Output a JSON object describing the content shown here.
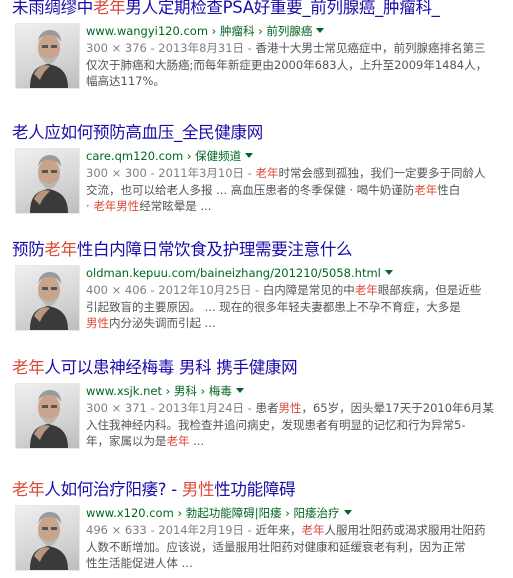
{
  "results": [
    {
      "title_parts": [
        {
          "text": "未雨绸缪中",
          "hl": false
        },
        {
          "text": "老年",
          "hl": true
        },
        {
          "text": "男人定期检查PSA好重要_前列腺癌_肿瘤科_",
          "hl": false
        }
      ],
      "url": "www.wangyi120.com",
      "crumbs": "› 肿瘤科 › 前列腺癌",
      "snippet_lines": [
        [
          {
            "text": "300 × 376 - 2013年8月31日 - ",
            "cls": "meta"
          },
          {
            "text": "香港十大男士常见癌症中，前列腺癌排名第三",
            "cls": ""
          }
        ],
        [
          {
            "text": "仅次于肺癌和大肠癌;而每年新症更由2000年683人，上升至2009年1484人，",
            "cls": ""
          }
        ],
        [
          {
            "text": "幅高达117%。",
            "cls": ""
          }
        ]
      ]
    },
    {
      "title_parts": [
        {
          "text": "老人应如何预防高血压_全民健康网",
          "hl": false
        }
      ],
      "url": "care.qm120.com",
      "crumbs": "› 保健频道",
      "snippet_lines": [
        [
          {
            "text": "300 × 300 - 2011年3月10日 - ",
            "cls": "meta"
          },
          {
            "text": "老年",
            "cls": "hl"
          },
          {
            "text": "时常会感到孤独，我们一定要多于同龄人",
            "cls": ""
          }
        ],
        [
          {
            "text": "交流，也可以给老人多报 ... 高血压患者的冬季保健 · 喝牛奶谨防",
            "cls": ""
          },
          {
            "text": "老年",
            "cls": "hl"
          },
          {
            "text": "性白",
            "cls": ""
          }
        ],
        [
          {
            "text": "· ",
            "cls": ""
          },
          {
            "text": "老年男性",
            "cls": "hl"
          },
          {
            "text": "经常眩晕是 ...",
            "cls": ""
          }
        ]
      ]
    },
    {
      "title_parts": [
        {
          "text": "预防",
          "hl": false
        },
        {
          "text": "老年",
          "hl": true
        },
        {
          "text": "性白内障日常饮食及护理需要注意什么",
          "hl": false
        }
      ],
      "url": "oldman.kepuu.com/baineizhang/201210/5058.html",
      "crumbs": "",
      "snippet_lines": [
        [
          {
            "text": "400 × 406 - 2012年10月25日 - ",
            "cls": "meta"
          },
          {
            "text": "白内障是常见的中",
            "cls": ""
          },
          {
            "text": "老年",
            "cls": "hl"
          },
          {
            "text": "眼部疾病，但是近些",
            "cls": ""
          }
        ],
        [
          {
            "text": "引起致盲的主要原因。 ... 现在的很多年轻夫妻都患上不孕不育症，大多是",
            "cls": ""
          }
        ],
        [
          {
            "text": "男性",
            "cls": "hl"
          },
          {
            "text": "内分泌失调而引起 ...",
            "cls": ""
          }
        ]
      ]
    },
    {
      "title_parts": [
        {
          "text": "老年",
          "hl": true
        },
        {
          "text": "人可以患神经梅毒  男科  携手健康网",
          "hl": false
        }
      ],
      "url": "www.xsjk.net",
      "crumbs": "› 男科 › 梅毒",
      "snippet_lines": [
        [
          {
            "text": "300 × 371 - 2013年1月24日 - ",
            "cls": "meta"
          },
          {
            "text": "患者",
            "cls": ""
          },
          {
            "text": "男性",
            "cls": "hl"
          },
          {
            "text": "，65岁，因头晕17天于2010年6月某",
            "cls": ""
          }
        ],
        [
          {
            "text": "入住我神经内科。我检查并追问病史，发现患者有明显的记忆和行为异常5-",
            "cls": ""
          }
        ],
        [
          {
            "text": "年，家属以为是",
            "cls": ""
          },
          {
            "text": "老年",
            "cls": "hl"
          },
          {
            "text": " ...",
            "cls": ""
          }
        ]
      ]
    },
    {
      "title_parts": [
        {
          "text": "老年",
          "hl": true
        },
        {
          "text": "人如何治疗阳痿? - ",
          "hl": false
        },
        {
          "text": "男性",
          "hl": true
        },
        {
          "text": "性功能障碍",
          "hl": false
        }
      ],
      "url": "www.x120.com",
      "crumbs": "› 勃起功能障碍|阳痿 › 阳痿治疗",
      "snippet_lines": [
        [
          {
            "text": "496 × 633 - 2014年2月19日 - ",
            "cls": "meta"
          },
          {
            "text": "近年来，",
            "cls": ""
          },
          {
            "text": "老年",
            "cls": "hl"
          },
          {
            "text": "人服用壮阳药或渴求服用壮阳药",
            "cls": ""
          }
        ],
        [
          {
            "text": "人数不断增加。应该说，适量服用壮阳药对健康和延缓衰老有利，因为正常",
            "cls": ""
          }
        ],
        [
          {
            "text": "性生活能促进人体 ...",
            "cls": ""
          }
        ]
      ]
    }
  ]
}
